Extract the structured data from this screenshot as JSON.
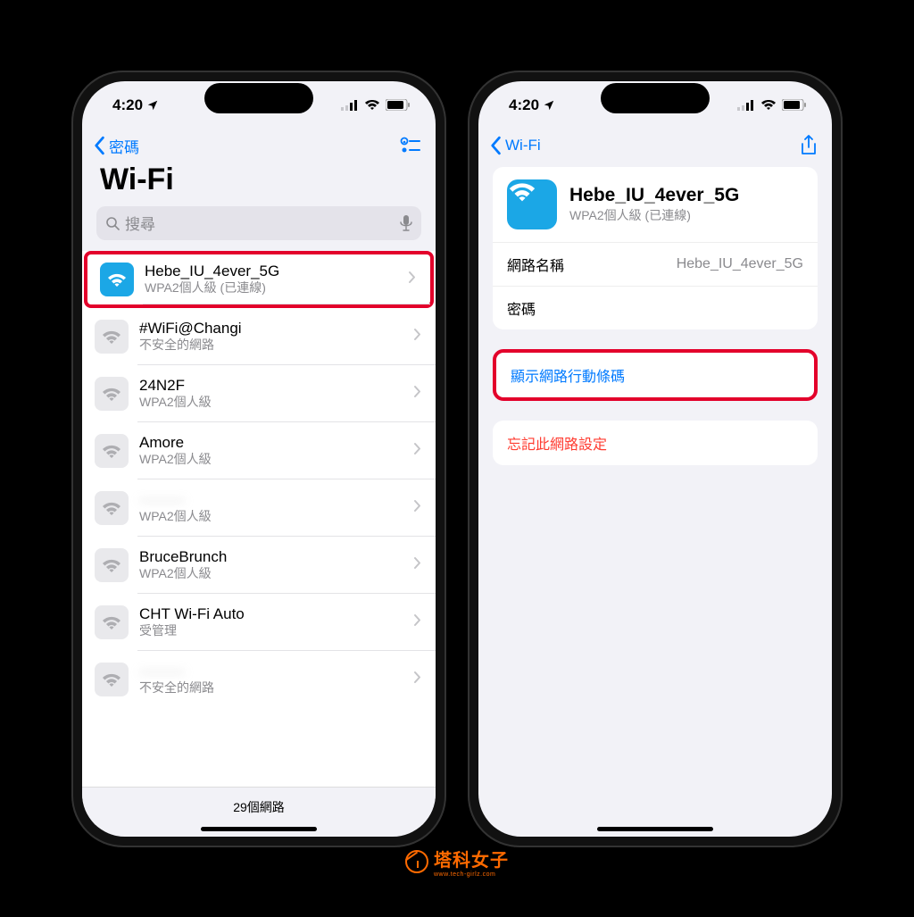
{
  "status": {
    "time": "4:20",
    "location_arrow": "▸"
  },
  "left": {
    "back_label": "密碼",
    "title": "Wi-Fi",
    "search_placeholder": "搜尋",
    "footer": "29個網路",
    "networks": [
      {
        "name": "Hebe_IU_4ever_5G",
        "sub": "WPA2個人級 (已連線)",
        "active": true,
        "highlight": true,
        "blurred": false
      },
      {
        "name": "#WiFi@Changi",
        "sub": "不安全的網路",
        "active": false,
        "highlight": false,
        "blurred": false
      },
      {
        "name": "24N2F",
        "sub": "WPA2個人級",
        "active": false,
        "highlight": false,
        "blurred": false
      },
      {
        "name": "Amore",
        "sub": "WPA2個人級",
        "active": false,
        "highlight": false,
        "blurred": false
      },
      {
        "name": "———",
        "sub": "WPA2個人級",
        "active": false,
        "highlight": false,
        "blurred": true
      },
      {
        "name": "BruceBrunch",
        "sub": "WPA2個人級",
        "active": false,
        "highlight": false,
        "blurred": false
      },
      {
        "name": "CHT Wi-Fi Auto",
        "sub": "受管理",
        "active": false,
        "highlight": false,
        "blurred": false
      },
      {
        "name": "———",
        "sub": "不安全的網路",
        "active": false,
        "highlight": false,
        "blurred": true
      }
    ]
  },
  "right": {
    "back_label": "Wi-Fi",
    "network_name": "Hebe_IU_4ever_5G",
    "network_sub": "WPA2個人級 (已連線)",
    "name_label": "網路名稱",
    "name_value": "Hebe_IU_4ever_5G",
    "password_label": "密碼",
    "qr_action": "顯示網路行動條碼",
    "forget_action": "忘記此網路設定"
  },
  "watermark": {
    "text": "塔科女子",
    "sub": "www.tech-girlz.com"
  }
}
